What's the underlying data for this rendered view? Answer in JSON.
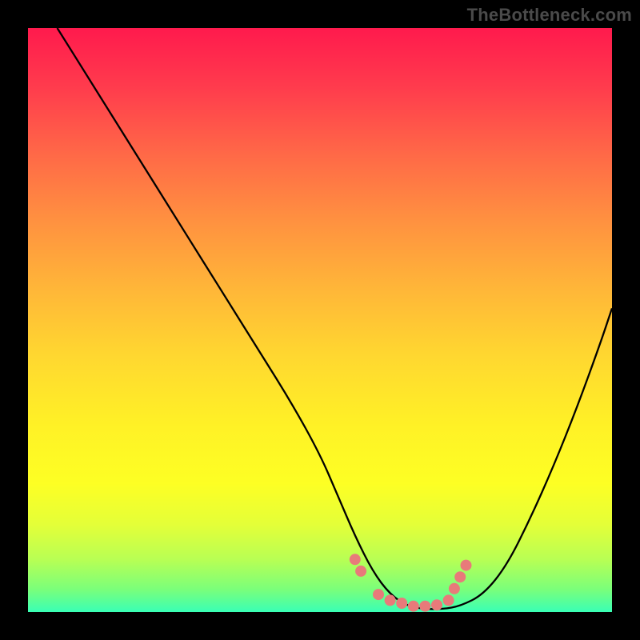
{
  "watermark": "TheBottleneck.com",
  "chart_data": {
    "type": "line",
    "title": "",
    "xlabel": "",
    "ylabel": "",
    "xlim": [
      0,
      100
    ],
    "ylim": [
      0,
      100
    ],
    "background_gradient": {
      "stops": [
        {
          "pos": 0,
          "color": "#ff1a4d"
        },
        {
          "pos": 10,
          "color": "#ff3b4d"
        },
        {
          "pos": 22,
          "color": "#ff6a47"
        },
        {
          "pos": 33,
          "color": "#ff9140"
        },
        {
          "pos": 45,
          "color": "#ffb738"
        },
        {
          "pos": 56,
          "color": "#ffd730"
        },
        {
          "pos": 68,
          "color": "#fff126"
        },
        {
          "pos": 78,
          "color": "#fdff24"
        },
        {
          "pos": 85,
          "color": "#e4ff38"
        },
        {
          "pos": 91,
          "color": "#b8ff54"
        },
        {
          "pos": 96,
          "color": "#7cff79"
        },
        {
          "pos": 100,
          "color": "#39ffb5"
        }
      ]
    },
    "series": [
      {
        "name": "bottleneck-curve",
        "x": [
          5,
          10,
          15,
          20,
          25,
          30,
          35,
          40,
          45,
          50,
          53,
          56,
          59,
          62,
          65,
          68,
          71,
          74,
          78,
          82,
          86,
          90,
          94,
          98,
          100
        ],
        "y": [
          100,
          92,
          84,
          76,
          68,
          60,
          52,
          44,
          36,
          27,
          20,
          13,
          7,
          3,
          1,
          0.5,
          0.5,
          1,
          3,
          8,
          16,
          25,
          35,
          46,
          52
        ]
      }
    ],
    "scatter": {
      "name": "highlight-points",
      "color": "#e87a7a",
      "points": [
        {
          "x": 56,
          "y": 9
        },
        {
          "x": 57,
          "y": 7
        },
        {
          "x": 60,
          "y": 3
        },
        {
          "x": 62,
          "y": 2
        },
        {
          "x": 64,
          "y": 1.5
        },
        {
          "x": 66,
          "y": 1
        },
        {
          "x": 68,
          "y": 1
        },
        {
          "x": 70,
          "y": 1.2
        },
        {
          "x": 72,
          "y": 2
        },
        {
          "x": 73,
          "y": 4
        },
        {
          "x": 74,
          "y": 6
        },
        {
          "x": 75,
          "y": 8
        }
      ]
    }
  }
}
